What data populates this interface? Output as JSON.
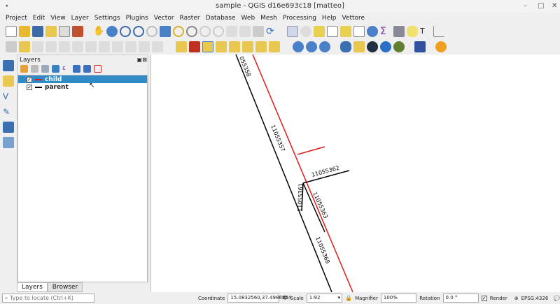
{
  "window": {
    "title": "sample - QGIS d16e693c18 [matteo]"
  },
  "menu": [
    "Project",
    "Edit",
    "View",
    "Layer",
    "Settings",
    "Plugins",
    "Vector",
    "Raster",
    "Database",
    "Web",
    "Mesh",
    "Processing",
    "Help",
    "Vettore"
  ],
  "layers_panel": {
    "title": "Layers",
    "items": [
      {
        "name": "child",
        "checked": true,
        "selected": true,
        "color": "#e31a1c"
      },
      {
        "name": "parent",
        "checked": true,
        "selected": false,
        "color": "#000000"
      }
    ],
    "tabs": [
      "Layers",
      "Browser"
    ]
  },
  "map": {
    "labels": [
      "055358",
      "11055357",
      "11055362",
      "11055361",
      "11055363",
      "11055368"
    ]
  },
  "status": {
    "locator_placeholder": "Type to locate (Ctrl+K)",
    "coordinate_label": "Coordinate",
    "coordinate": "15.0832560,37.4986844",
    "scale_label": "Scale",
    "scale": "1:92",
    "magnifier_label": "Magnifier",
    "magnifier": "100%",
    "rotation_label": "Rotation",
    "rotation": "0.0 °",
    "render_label": "Render",
    "render_checked": true,
    "crs": "EPSG:4326"
  }
}
